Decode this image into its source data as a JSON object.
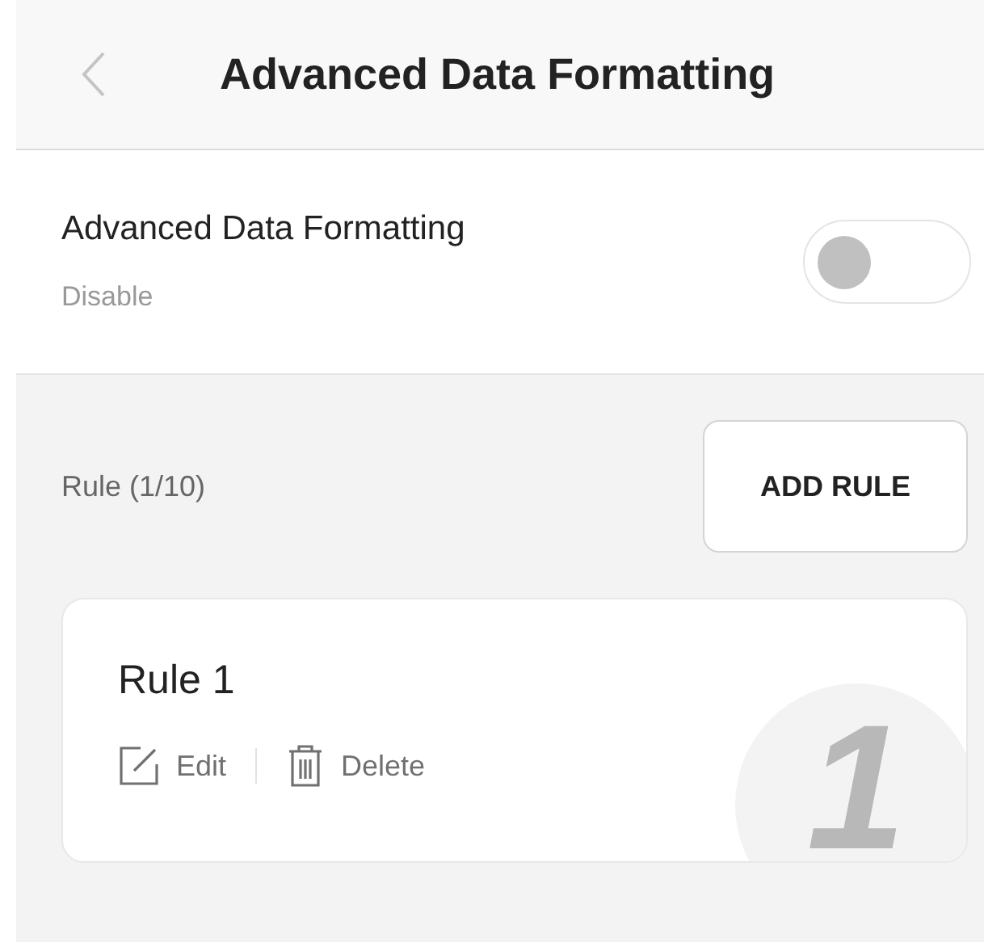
{
  "header": {
    "title": "Advanced Data Formatting"
  },
  "setting": {
    "title": "Advanced Data Formatting",
    "status": "Disable",
    "on": false
  },
  "rules": {
    "count_label": "Rule (1/10)",
    "add_button": "ADD RULE",
    "items": [
      {
        "name": "Rule 1",
        "number": "1",
        "edit": "Edit",
        "delete": "Delete"
      }
    ]
  }
}
